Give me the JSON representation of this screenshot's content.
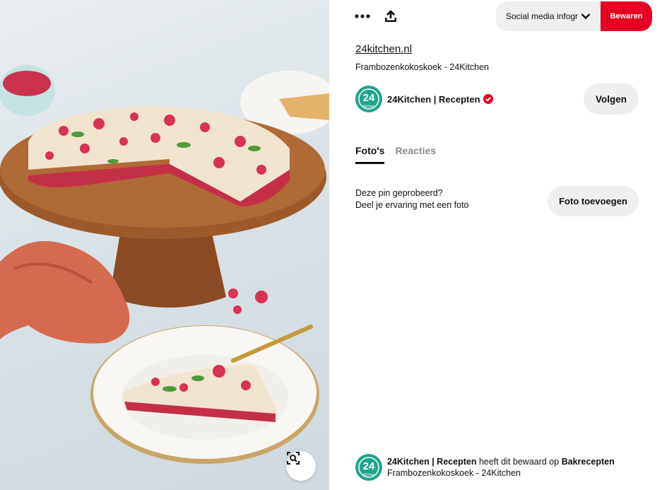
{
  "toolbar": {
    "more_icon": "more-dots-icon",
    "share_icon": "share-upload-icon",
    "board_select": "Social media infogr...",
    "save_label": "Bewaren"
  },
  "pin": {
    "source": "24kitchen.nl",
    "subtitle": "Frambozenkokoskoek - 24Kitchen"
  },
  "creator": {
    "avatar_text": "24",
    "avatar_small": "Kitchen",
    "name": "24Kitchen | Recepten",
    "follow_label": "Volgen"
  },
  "tabs": [
    {
      "label": "Foto's",
      "active": true
    },
    {
      "label": "Reacties",
      "active": false
    }
  ],
  "tried": {
    "line1": "Deze pin geprobeerd?",
    "line2": "Deel je ervaring met een foto",
    "button": "Foto toevoegen"
  },
  "saved_by": {
    "user": "24Kitchen | Recepten",
    "middle": "heeft dit bewaard op",
    "board": "Bakrecepten",
    "subtitle": "Frambozenkokoskoek - 24Kitchen"
  },
  "colors": {
    "accent": "#e60023",
    "avatar": "#1fa58d",
    "button_bg": "#efefef"
  }
}
